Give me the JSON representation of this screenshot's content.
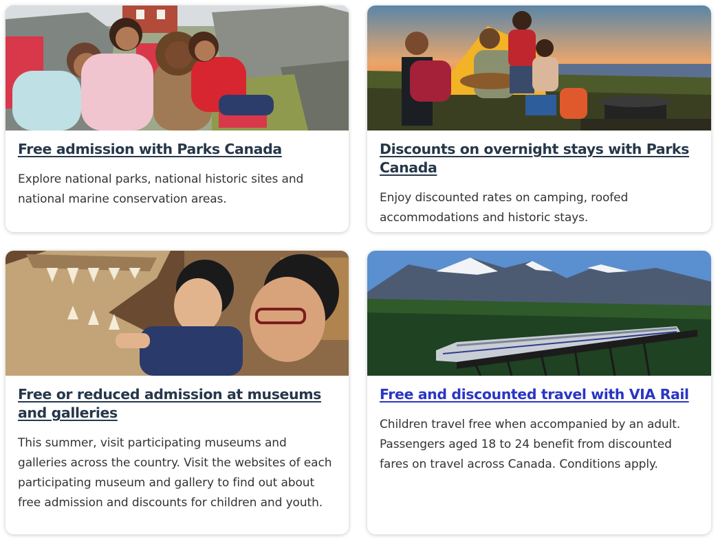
{
  "cards": [
    {
      "title": "Free admission with Parks Canada",
      "description": "Explore national parks, national historic sites and national marine conservation areas.",
      "image": "family-sitting-on-red-chairs-by-rocks-photo"
    },
    {
      "title": "Discounts on overnight stays with Parks Canada",
      "description": "Enjoy discounted rates on camping, roofed accommodations and historic stays.",
      "image": "friends-camping-at-sunset-photo"
    },
    {
      "title": "Free or reduced admission at museums and galleries",
      "description": "This summer, visit participating museums and galleries across the country. Visit the websites of each participating museum and gallery to find out about free admission and discounts for children and youth.",
      "image": "child-touching-dinosaur-skull-photo"
    },
    {
      "title": "Free and discounted travel with VIA Rail",
      "description": "Children travel free when accompanied by an adult. Passengers aged 18 to 24 benefit from discounted fares on travel across Canada. Conditions apply.",
      "image": "train-crossing-bridge-mountains-photo"
    }
  ],
  "colors": {
    "title_visited": "#26374a",
    "title_active": "#2a35c4",
    "body_text": "#333333"
  }
}
